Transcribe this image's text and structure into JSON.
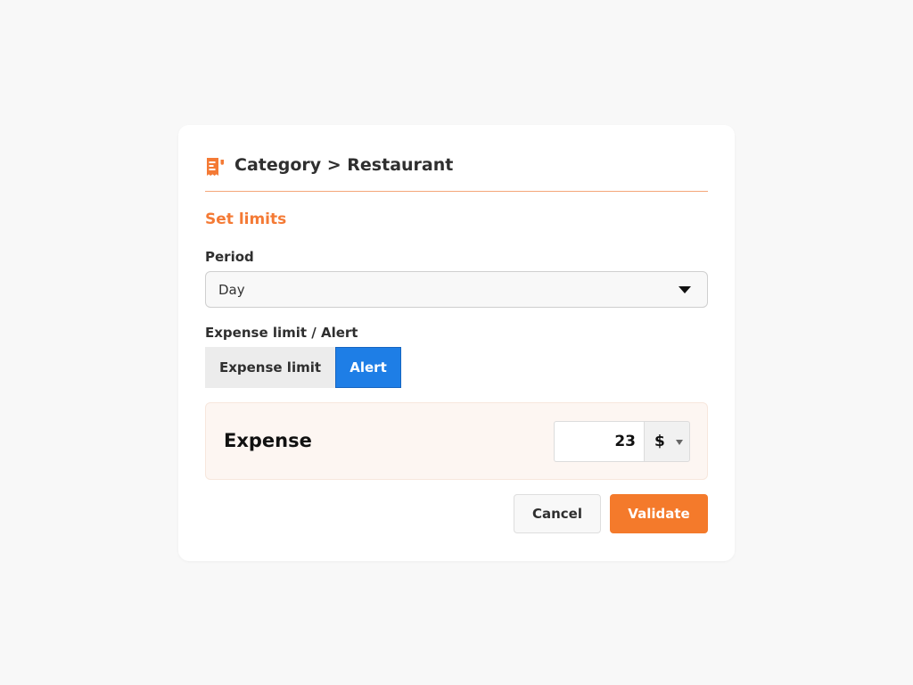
{
  "header": {
    "icon": "receipt-icon",
    "title": "Category > Restaurant"
  },
  "form": {
    "section_title": "Set limits",
    "period": {
      "label": "Period",
      "value": "Day"
    },
    "mode": {
      "label": "Expense limit / Alert",
      "options": [
        "Expense limit",
        "Alert"
      ],
      "selected": "Alert"
    },
    "expense": {
      "title": "Expense",
      "amount": "23",
      "currency": "$"
    }
  },
  "actions": {
    "cancel_label": "Cancel",
    "validate_label": "Validate"
  },
  "colors": {
    "accent": "#f47a2b",
    "selected_toggle": "#1e7ee6",
    "background": "#f8f8f8"
  }
}
